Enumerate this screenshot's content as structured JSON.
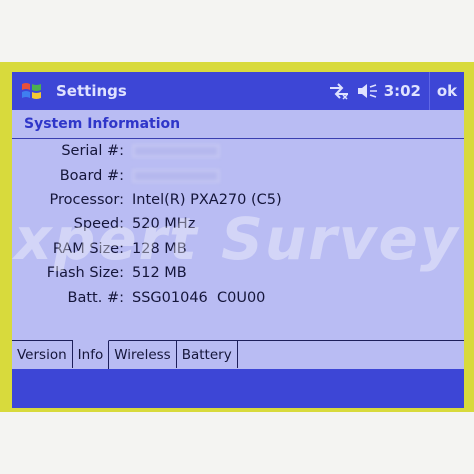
{
  "window": {
    "title": "Settings",
    "clock": "3:02",
    "ok_label": "ok"
  },
  "header": {
    "section_title": "System Information"
  },
  "info_rows": [
    {
      "label": "Serial #:",
      "value": null,
      "obscured": true
    },
    {
      "label": "Board #:",
      "value": null,
      "obscured": true
    },
    {
      "label": "Processor:",
      "value": "Intel(R) PXA270 (C5)"
    },
    {
      "label": "Speed:",
      "value": "520 MHz"
    },
    {
      "label": "RAM Size:",
      "value": "128 MB"
    },
    {
      "label": "Flash Size:",
      "value": "512 MB"
    },
    {
      "label": "Batt. #:",
      "value": "SSG01046  C0U00"
    }
  ],
  "tabs": [
    {
      "label": "Version"
    },
    {
      "label": "Info",
      "active": true
    },
    {
      "label": "Wireless"
    },
    {
      "label": "Battery"
    }
  ],
  "watermark": "xpert Survey",
  "icons": {
    "start": "windows-flag-icon",
    "connectivity": "connectivity-icon",
    "volume": "speaker-icon"
  },
  "colors": {
    "titlebar": "#3d46d6",
    "screen_bg": "#b9bcf3",
    "bezel": "#d8da3c",
    "section_title": "#2f36c9"
  }
}
